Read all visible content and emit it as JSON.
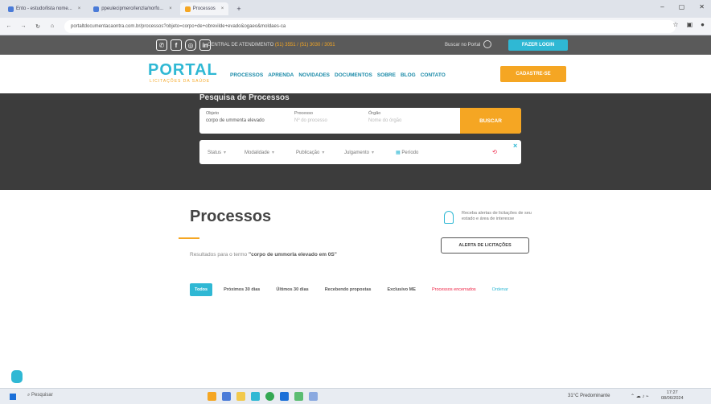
{
  "browser": {
    "tabs": [
      {
        "label": "Ento - estudo/lista nome..."
      },
      {
        "label": "ppeulecipmero/lenzla/norfo..."
      },
      {
        "label": "Processos"
      }
    ],
    "url": "portaltdocumentacaontra.com.br/processos?objeto=corpo+de+obrevilde+evado&ogaeo&moldaes-ca"
  },
  "site": {
    "top": {
      "contact_label": "CENTRAL DE ATENDIMENTO",
      "contact_phone": "(51) 3551 / (51) 3030 / 3051",
      "search_label": "Buscar no Portal",
      "login_label": "FAZER LOGIN"
    },
    "logo": "PORTAL",
    "logo_sub": "LICITAÇÕES DA SAÚDE",
    "nav": [
      "PROCESSOS",
      "APRENDA",
      "NOVIDADES",
      "DOCUMENTOS",
      "SOBRE",
      "BLOG",
      "CONTATO"
    ],
    "cta": "CADASTRE-SE"
  },
  "hero": {
    "title": "Pesquisa de Processos",
    "fields": [
      {
        "label": "Objeto",
        "value": "corpo de ummenta elevado"
      },
      {
        "label": "Processo",
        "placeholder": "Nº do processo"
      },
      {
        "label": "Órgão",
        "placeholder": "Nome do órgão"
      }
    ],
    "search_button": "BUSCAR",
    "filters": [
      "Status",
      "Modalidade",
      "Publicação",
      "Julgamento",
      "Período"
    ],
    "close": "×",
    "clear": "⟲"
  },
  "content": {
    "title": "Processos",
    "results_prefix": "Resultados para o termo",
    "results_term": "\"corpo de ummorla elevado em 0S\"",
    "alert_text": "Receba alertas de licitações de seu estado e área de interesse",
    "alert_button": "ALERTA DE LICITAÇÕES",
    "tabs": [
      "Todos",
      "Próximos 30 dias",
      "Últimos 30 dias",
      "Recebendo propostas",
      "Exclusivo ME",
      "Processos encerrados",
      "Ordenar"
    ]
  },
  "taskbar": {
    "search": "Pesquisar",
    "weather": "31°C Predominante",
    "time": "17:27",
    "date": "08/06/2024"
  },
  "colors": {
    "accent": "#2fb8d4",
    "orange": "#f5a623",
    "dark": "#3c3c3c"
  }
}
